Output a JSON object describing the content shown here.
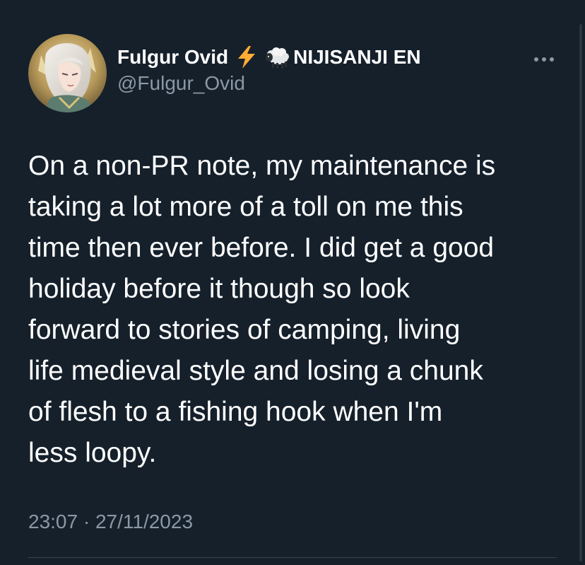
{
  "author": {
    "display_name": "Fulgur Ovid",
    "emoji_1": "lightning-emoji",
    "emoji_2": "sheep-emoji",
    "display_name_suffix": "NIJISANJI EN",
    "handle": "@Fulgur_Ovid"
  },
  "tweet": {
    "text_lines": [
      "On a non-PR note, my maintenance is",
      "taking a lot more of a toll on me this",
      "time then ever before. I did get a good",
      "holiday before it though so look",
      "forward to stories of camping, living",
      "life medieval style and losing a chunk",
      "of flesh to a fishing hook when I'm",
      "less loopy."
    ],
    "time": "23:07",
    "separator": "·",
    "date": "27/11/2023"
  },
  "colors": {
    "background": "#15202b",
    "text_primary": "#ffffff",
    "text_secondary": "#8b98a5",
    "divider": "#38444d"
  }
}
